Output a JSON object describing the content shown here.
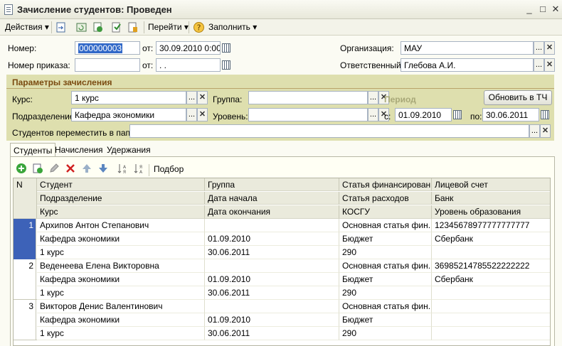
{
  "window": {
    "title": "Зачисление студентов: Проведен"
  },
  "toolbar": {
    "actions": "Действия",
    "goto": "Перейти",
    "fill": "Заполнить"
  },
  "header": {
    "number_label": "Номер:",
    "number_value": "000000003",
    "from_label": "от:",
    "date_value": "30.09.2010  0:00:",
    "order_label": "Номер приказа:",
    "order_value": "",
    "order_from_label": "от:",
    "order_date_value": " .  .",
    "org_label": "Организация:",
    "org_value": "МАУ",
    "resp_label": "Ответственный:",
    "resp_value": "Глебова А.И."
  },
  "params": {
    "title": "Параметры зачисления",
    "course_label": "Курс:",
    "course_value": "1 курс",
    "group_label": "Группа:",
    "group_value": "",
    "period_label": "Период",
    "update_button": "Обновить в ТЧ",
    "division_label": "Подразделение:",
    "division_value": "Кафедра экономики",
    "level_label": "Уровень:",
    "level_value": "",
    "from_label": "с:",
    "from_value": "01.09.2010",
    "to_label": "по:",
    "to_value": "30.06.2011",
    "move_label": "Студентов переместить в папку:",
    "move_value": ""
  },
  "tabs": [
    "Студенты",
    "Начисления",
    "Удержания"
  ],
  "grid_toolbar": {
    "pick": "Подбор"
  },
  "grid": {
    "header_rows": [
      [
        "Студент",
        "Группа",
        "Статья финансирован...",
        "Лицевой счет"
      ],
      [
        "Подразделение",
        "Дата начала",
        "Статья расходов",
        "Банк"
      ],
      [
        "Курс",
        "Дата окончания",
        "КОСГУ",
        "Уровень образования"
      ]
    ],
    "n_header": "N",
    "rows": [
      {
        "n": "1",
        "lines": [
          [
            "Архипов Антон Степанович",
            "",
            "Основная статья фин...",
            "12345678977777777777"
          ],
          [
            "Кафедра экономики",
            "01.09.2010",
            "Бюджет",
            "Сбербанк"
          ],
          [
            "1 курс",
            "30.06.2011",
            "290",
            ""
          ]
        ]
      },
      {
        "n": "2",
        "lines": [
          [
            "Веденеева Елена Викторовна",
            "",
            "Основная статья фин...",
            "36985214785522222222"
          ],
          [
            "Кафедра экономики",
            "01.09.2010",
            "Бюджет",
            "Сбербанк"
          ],
          [
            "1 курс",
            "30.06.2011",
            "290",
            ""
          ]
        ]
      },
      {
        "n": "3",
        "lines": [
          [
            "Викторов Денис Валентинович",
            "",
            "Основная статья фин...",
            ""
          ],
          [
            "Кафедра экономики",
            "01.09.2010",
            "Бюджет",
            ""
          ],
          [
            "1 курс",
            "30.06.2011",
            "290",
            ""
          ]
        ]
      }
    ]
  }
}
